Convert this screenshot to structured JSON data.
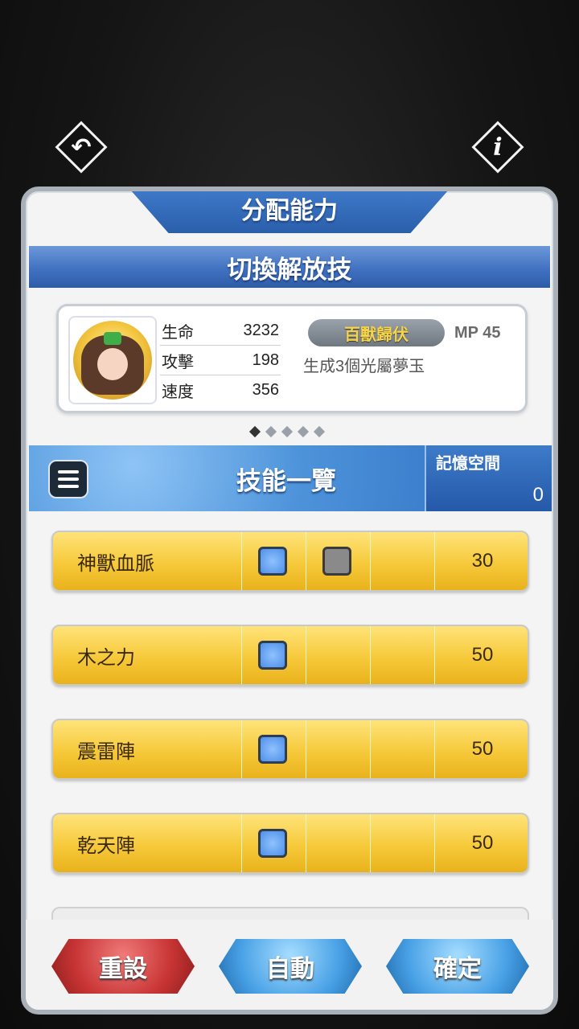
{
  "nav": {
    "back_icon": "↶",
    "info_icon": "i"
  },
  "panel": {
    "title": "分配能力",
    "subtitle": "切換解放技"
  },
  "character": {
    "stats": [
      {
        "label": "生命",
        "value": "3232"
      },
      {
        "label": "攻擊",
        "value": "198"
      },
      {
        "label": "速度",
        "value": "356"
      }
    ],
    "skill_name": "百獸歸伏",
    "mp": "MP 45",
    "skill_desc": "生成3個光屬夢玉"
  },
  "pager": {
    "total": 5,
    "active": 0
  },
  "list": {
    "title": "技能一覽",
    "memory_label": "記憶空間",
    "memory_value": "0"
  },
  "skills": [
    {
      "name": "神獸血脈",
      "slots": [
        "blue",
        "gray",
        "",
        ""
      ],
      "cost": "30"
    },
    {
      "name": "木之力",
      "slots": [
        "blue",
        "",
        "",
        ""
      ],
      "cost": "50"
    },
    {
      "name": "震雷陣",
      "slots": [
        "blue",
        "",
        "",
        ""
      ],
      "cost": "50"
    },
    {
      "name": "乾天陣",
      "slots": [
        "blue",
        "",
        "",
        ""
      ],
      "cost": "50"
    }
  ],
  "buttons": {
    "reset": "重設",
    "auto": "自動",
    "confirm": "確定"
  }
}
